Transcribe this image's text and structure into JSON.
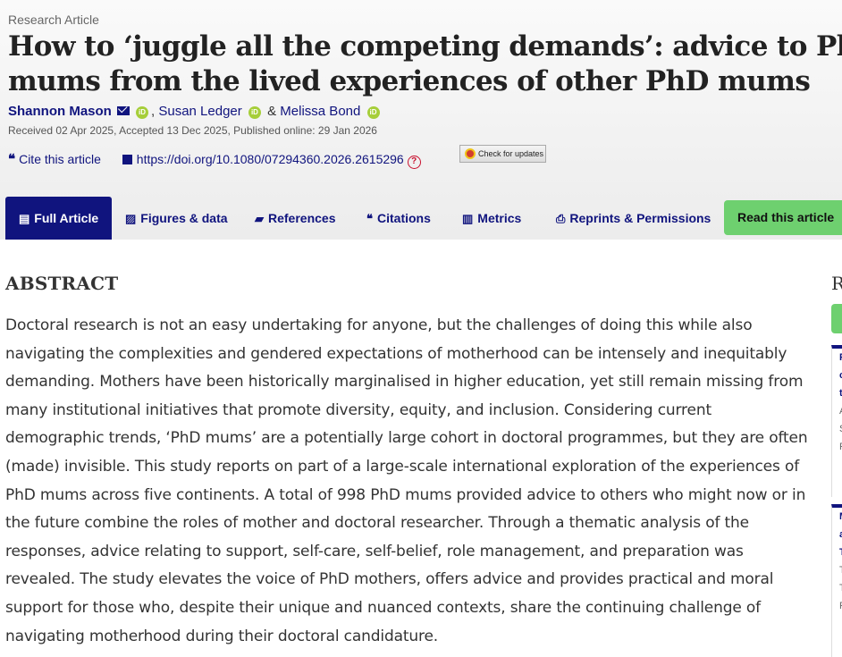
{
  "article": {
    "type": "Research Article",
    "title_line1": "How to ‘juggle all the competing demands’: advice to PhD",
    "title_line2": "mums from the lived experiences of other PhD mums",
    "authors": {
      "a1": "Shannon Mason",
      "a2": "Susan Ledger",
      "sep1": ",",
      "amp": "&",
      "a3": "Melissa Bond"
    },
    "dates": "Received 02 Apr 2025, Accepted 13 Dec 2025, Published online: 29 Jan 2026",
    "cite_label": "Cite this article",
    "doi": "https://doi.org/10.1080/07294360.2026.2615296",
    "check_updates": "Check for updates"
  },
  "tabs": [
    {
      "label": "Full Article",
      "icon": "document-icon"
    },
    {
      "label": "Figures & data",
      "icon": "image-icon"
    },
    {
      "label": "References",
      "icon": "book-icon"
    },
    {
      "label": "Citations",
      "icon": "quote-icon"
    },
    {
      "label": "Metrics",
      "icon": "bar-chart-icon"
    },
    {
      "label": "Reprints & Permissions",
      "icon": "print-icon"
    }
  ],
  "read_button": "Read this article",
  "abstract": {
    "heading": "ABSTRACT",
    "lines": [
      "Doctoral research is not an easy undertaking for anyone, but the challenges of doing this while also",
      "navigating the complexities and gendered expectations of motherhood can be intensely and inequitably",
      "demanding. Mothers have been historically marginalised in higher education, yet still remain missing from",
      "many institutional initiatives that promote diversity, equity, and inclusion. Considering current",
      "demographic trends, ‘PhD mums’ are a potentially large cohort in doctoral programmes, but they are often",
      "(made) invisible. This study reports on part of a large-scale international exploration of the experiences of",
      "PhD mums across five continents. A total of 998 PhD mums provided advice to others who might now or in",
      "the future combine the roles of mother and doctoral researcher. Through a thematic analysis of the",
      "responses, advice relating to support, self-care, self-belief, role management, and preparation was",
      "revealed. The study elevates the voice of PhD mothers, offers advice and provides practical and moral",
      "support for those who, despite their unique and nuanced contexts, share the continuing challenge of",
      "navigating motherhood during their doctoral candidature."
    ]
  },
  "sidebar": {
    "heading_fragment": "R",
    "card1": [
      "F",
      "c",
      "t",
      "",
      "A",
      "S",
      "P"
    ],
    "card2": [
      "M",
      "a",
      "T",
      "",
      "T",
      "T",
      "P"
    ]
  },
  "colors": {
    "brand_navy": "#10147e",
    "read_green": "#6ed06f",
    "orcid_green": "#a6ce39",
    "oa_red": "#c8102e"
  }
}
